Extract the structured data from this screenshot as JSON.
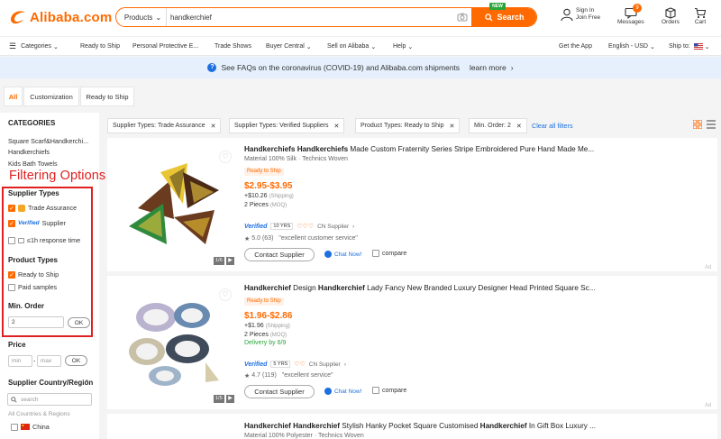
{
  "header": {
    "logo": "Alibaba.com",
    "search_category": "Products",
    "search_query": "handkerchief",
    "search_button": "Search",
    "new_badge": "NEW",
    "sign_in": "Sign In",
    "join_free": "Join Free",
    "messages_label": "Messages",
    "messages_count": "9",
    "orders_label": "Orders",
    "cart_label": "Cart"
  },
  "nav": {
    "categories": "Categories",
    "items": [
      "Ready to Ship",
      "Personal Protective E...",
      "Trade Shows",
      "Buyer Central",
      "Sell on Alibaba",
      "Help"
    ],
    "get_app": "Get the App",
    "language": "English - USD",
    "ship_to": "Ship to:"
  },
  "banner": {
    "text": "See FAQs on the coronavirus (COVID-19) and Alibaba.com shipments",
    "link": "learn more"
  },
  "tabs": [
    "All",
    "Customization",
    "Ready to Ship"
  ],
  "sidebar": {
    "categories_title": "CATEGORIES",
    "categories": [
      "Square Scarf&Handkerchi...",
      "Handkerchiefs",
      "Kids Bath Towels"
    ],
    "annotation": "Filtering Options",
    "supplier_types_title": "Supplier Types",
    "trade_assurance": "Trade Assurance",
    "verified_badge": "Verified",
    "verified_supplier": "Supplier",
    "response_time": "≤1h response time",
    "product_types_title": "Product Types",
    "ready_to_ship": "Ready to Ship",
    "paid_samples": "Paid samples",
    "min_order_title": "Min. Order",
    "min_order_value": "2",
    "ok": "OK",
    "price_title": "Price",
    "price_min": "min",
    "price_max": "max",
    "price_sep": "-",
    "country_title": "Supplier Country/Region",
    "country_search": "search",
    "all_countries": "All Countries & Regions",
    "china": "China"
  },
  "chips": [
    "Supplier Types: Trade Assurance",
    "Supplier Types: Verified Suppliers",
    "Product Types: Ready to Ship",
    "Min. Order: 2"
  ],
  "clear_filters": "Clear all filters",
  "products": [
    {
      "title_parts": [
        [
          "Handkerchiefs Handkerchiefs",
          true
        ],
        [
          " Made Custom Fraternity Series Stripe Embroidered Pure Hand Made Me...",
          false
        ]
      ],
      "material": "Material 100% Silk · Technics Woven",
      "ready_to_ship": "Ready to Ship",
      "price": "$2.95-$3.95",
      "shipping": "+$10.26",
      "shipping_note": "(Shipping)",
      "moq": "2 Pieces",
      "moq_note": "(MOQ)",
      "delivery": "",
      "verified": "Verified",
      "years": "10 YRS",
      "country": "CN Supplier",
      "rating": "5.0 (63)",
      "review": "\"excellent customer service\"",
      "contact": "Contact Supplier",
      "chat": "Chat Now!",
      "compare": "compare",
      "pager": "1/6",
      "ad": "Ad"
    },
    {
      "title_parts": [
        [
          "Handkerchief",
          true
        ],
        [
          " Design ",
          false
        ],
        [
          "Handkerchief",
          true
        ],
        [
          " Lady Fancy New Branded Luxury Designer Head Printed Square Sc...",
          false
        ]
      ],
      "material": "",
      "ready_to_ship": "Ready to Ship",
      "price": "$1.96-$2.86",
      "shipping": "+$1.96",
      "shipping_note": "(Shipping)",
      "moq": "2 Pieces",
      "moq_note": "(MOQ)",
      "delivery": "Delivery by 6/9",
      "verified": "Verified",
      "years": "5 YRS",
      "country": "CN Supplier",
      "rating": "4.7 (119)",
      "review": "\"excellent service\"",
      "contact": "Contact Supplier",
      "chat": "Chat Now!",
      "compare": "compare",
      "pager": "1/5",
      "ad": "Ad"
    },
    {
      "title_parts": [
        [
          "Handkerchief Handkerchief",
          true
        ],
        [
          " Stylish Hanky Pocket Square Customised ",
          false
        ],
        [
          "Handkerchief",
          true
        ],
        [
          " In Gift Box Luxury ...",
          false
        ]
      ],
      "material": "Material 100% Polyester · Technics Woven"
    }
  ]
}
